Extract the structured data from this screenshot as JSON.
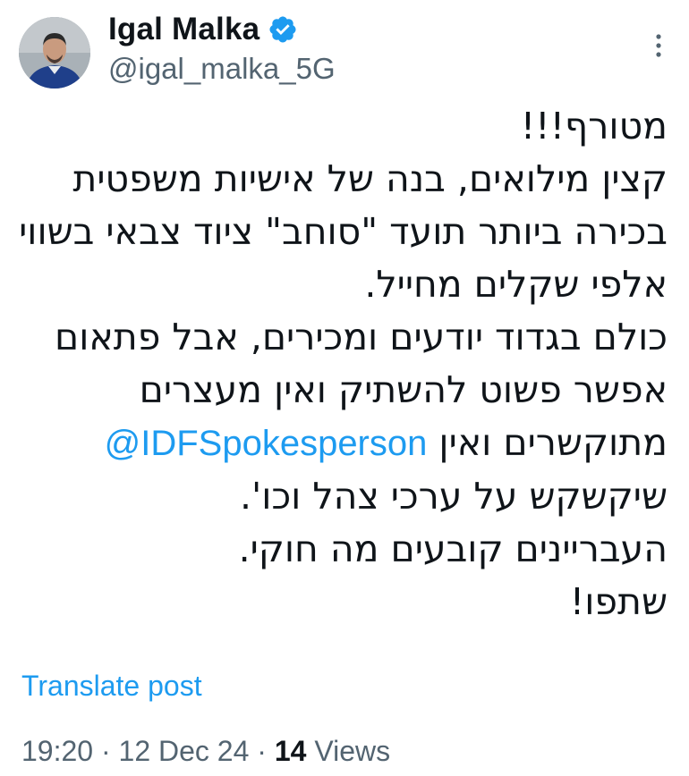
{
  "author": {
    "display_name": "Igal Malka",
    "handle": "@igal_malka_5G",
    "verified": true,
    "avatar_icon": "profile-photo"
  },
  "tweet": {
    "lines": {
      "l1": "מטורף!!!",
      "l2": "קצין מילואים, בנה של אישיות משפטית",
      "l3": "בכירה ביותר תועד \"סוחב\" ציוד צבאי בשווי",
      "l4": "אלפי שקלים מחייל.",
      "l5": "כולם בגדוד יודעים ומכירים, אבל פתאום",
      "l6": "אפשר פשוט להשתיק ואין מעצרים",
      "l7_text": "מתוקשרים ואין",
      "l7_mention": "@IDFSpokesperson",
      "l8": "שיקשקש על ערכי צהל וכו'.",
      "l9": "העבריינים קובעים מה חוקי.",
      "l10": "שתפו!"
    }
  },
  "translate_label": "Translate post",
  "meta": {
    "time": "19:20",
    "separator": "·",
    "date": "12 Dec 24",
    "views_count": "14",
    "views_label": "Views"
  },
  "colors": {
    "link": "#1d9bf0",
    "secondary": "#536471",
    "text": "#0f1419"
  }
}
